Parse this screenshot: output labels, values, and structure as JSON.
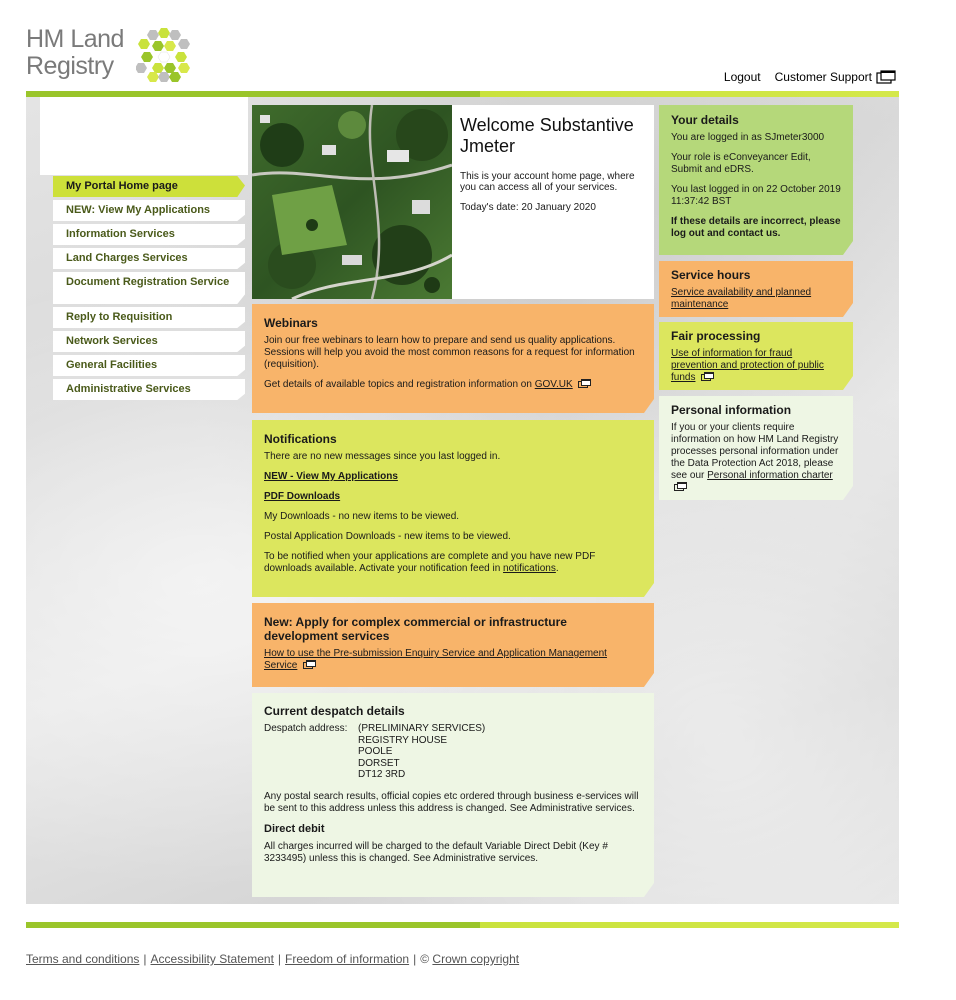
{
  "header": {
    "logo_line1": "HM Land",
    "logo_line2": "Registry",
    "logout": "Logout",
    "customer_support": "Customer Support"
  },
  "nav": {
    "items": [
      {
        "label": "My Portal Home page"
      },
      {
        "label": "NEW: View My Applications"
      },
      {
        "label": "Information Services"
      },
      {
        "label": "Land Charges Services"
      },
      {
        "label": "Document Registration Service"
      },
      {
        "label": "Reply to Requisition"
      },
      {
        "label": "Network Services"
      },
      {
        "label": "General Facilities"
      },
      {
        "label": "Administrative Services"
      }
    ]
  },
  "welcome": {
    "title": "Welcome Substantive Jmeter",
    "intro": "This is your account home page, where you can access all of your services.",
    "date": "Today's date: 20 January 2020"
  },
  "webinars": {
    "title": "Webinars",
    "text": "Join our free webinars to learn how to prepare and send us quality applications. Sessions will help you avoid the most common reasons for a request for information (requisition).",
    "details_prefix": "Get details of available topics and registration information on ",
    "details_link": "GOV.UK"
  },
  "notifications": {
    "title": "Notifications",
    "no_messages": "There are no new messages since you last logged in.",
    "view_apps_link": "NEW - View My Applications",
    "pdf_link": "PDF Downloads",
    "my_downloads": "My Downloads - no new items to be viewed.",
    "postal_downloads": "Postal Application Downloads - new items to be viewed.",
    "feed_prefix": "To be notified when your applications are complete and you have new PDF downloads available. Activate your notification feed in ",
    "feed_link": "notifications",
    "feed_suffix": "."
  },
  "complex": {
    "title": "New: Apply for complex commercial or infrastructure development services",
    "link": "How to use the Pre-submission Enquiry Service and Application Management Service"
  },
  "despatch": {
    "title": "Current despatch details",
    "address_label": "Despatch address:",
    "address_lines": [
      "(PRELIMINARY SERVICES)",
      "REGISTRY HOUSE",
      "POOLE",
      "DORSET",
      "DT12 3RD"
    ],
    "note": "Any postal search results, official copies etc ordered through business e-services will be sent to this address unless this address is changed. See Administrative services.",
    "dd_title": "Direct debit",
    "dd_text": "All charges incurred will be charged to the default Variable Direct Debit (Key # 3233495) unless this is changed. See Administrative services."
  },
  "your_details": {
    "title": "Your details",
    "logged_in": "You are logged in as SJmeter3000",
    "role": "Your role is eConveyancer Edit, Submit and eDRS.",
    "last_login": "You last logged in on 22 October 2019 11:37:42 BST",
    "warning": "If these details are incorrect, please log out and contact us."
  },
  "service_hours": {
    "title": "Service hours",
    "link": "Service availability and planned maintenance"
  },
  "fair_processing": {
    "title": "Fair processing",
    "link": "Use of information for fraud prevention and protection of public funds"
  },
  "personal_info": {
    "title": "Personal information",
    "text": "If you or your clients require information on how HM Land Registry processes personal information under the Data Protection Act 2018, please see our ",
    "link": "Personal information charter"
  },
  "footer": {
    "terms": "Terms and conditions",
    "accessibility": "Accessibility Statement",
    "foi": "Freedom of information",
    "copyright_symbol": "©",
    "crown": "Crown copyright"
  },
  "colors": {
    "brand_green": "#9ac52a",
    "lime": "#dce65e",
    "orange": "#f8b46a",
    "light_green": "#b5d87a",
    "pale_green": "#eef6e4"
  }
}
